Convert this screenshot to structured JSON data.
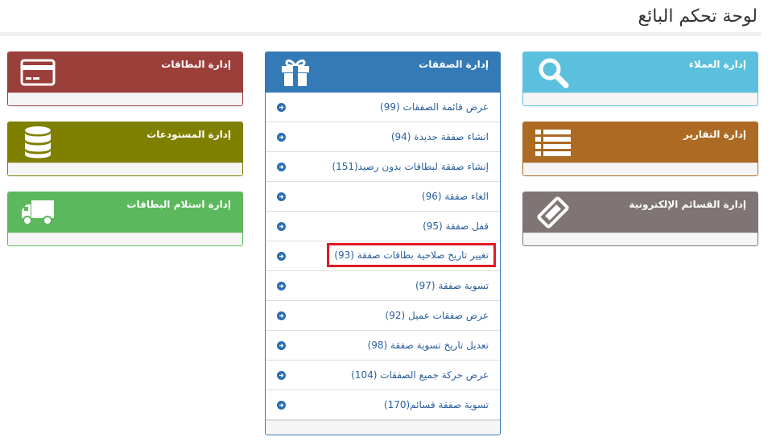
{
  "page": {
    "title": "لوحة تحكم البائع"
  },
  "panels": {
    "customers": {
      "label": "إدارة العملاء",
      "icon": "search-icon"
    },
    "reports": {
      "label": "إدارة التقارير",
      "icon": "list-icon"
    },
    "coupons": {
      "label": "إدارة القسائم الإلكترونية",
      "icon": "ticket-icon"
    },
    "deals": {
      "label": "إدارة الصفقات",
      "icon": "gift-icon"
    },
    "cards": {
      "label": "إدارة البطاقات",
      "icon": "credit-card-icon"
    },
    "warehouses": {
      "label": "إدارة المستودعات",
      "icon": "database-icon"
    },
    "receive": {
      "label": "إدارة استلام البطاقات",
      "icon": "truck-icon"
    }
  },
  "deals_menu": [
    {
      "label": "عرض قائمة الصفقات (99)"
    },
    {
      "label": "انشاء صفقة جديدة (94)"
    },
    {
      "label": "إنشاء صفقة لبطاقات بدون رصيد(151)"
    },
    {
      "label": "الغاء صفقة (96)"
    },
    {
      "label": "قفل صفقة (95)"
    },
    {
      "label": "تغيير تاريخ صلاحية بطاقات صفقة (93)"
    },
    {
      "label": "تسوية صفقة (97)"
    },
    {
      "label": "عرض صفقات عميل (92)"
    },
    {
      "label": "تعديل تاريخ تسوية صفقة (98)"
    },
    {
      "label": "عرض حركة جميع الصفقات (104)"
    },
    {
      "label": "تسوية صفقة قسائم(170)"
    }
  ],
  "colors": {
    "customers": "#5bc0de",
    "reports": "#ac6a23",
    "coupons": "#7f7575",
    "deals": "#337ab7",
    "cards": "#9b3f3b",
    "warehouses": "#808000",
    "receive": "#5cb85c",
    "highlight": "#e01b24"
  }
}
